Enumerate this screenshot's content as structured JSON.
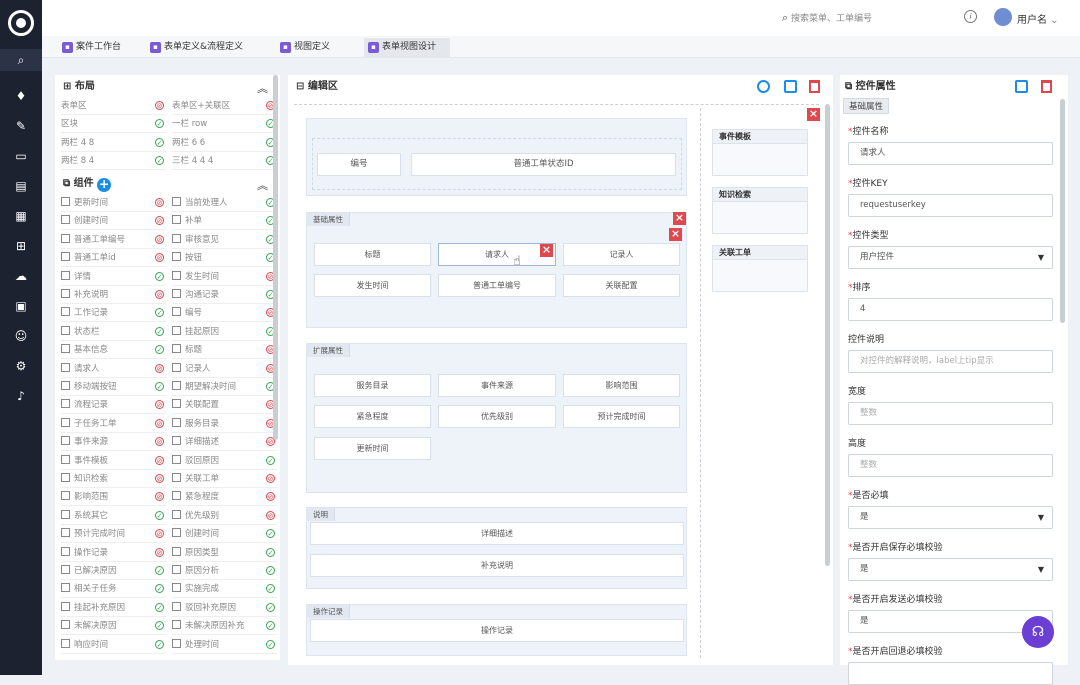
{
  "topbar": {
    "search_placeholder": "搜索菜单、工单编号",
    "username": "用户名",
    "dropdown": "⌄"
  },
  "tabs": [
    "案件工作台",
    "表单定义&流程定义",
    "视图定义",
    "表单视图设计"
  ],
  "layout_panel": {
    "title": "布局",
    "items": [
      {
        "l": "表单区",
        "ls": "no",
        "r": "表单区+关联区",
        "rs": "no"
      },
      {
        "l": "区块",
        "ls": "ok",
        "r": "一栏 row",
        "rs": "ok"
      },
      {
        "l": "两栏 4 8",
        "ls": "ok",
        "r": "两栏 6 6",
        "rs": "ok"
      },
      {
        "l": "两栏 8 4",
        "ls": "ok",
        "r": "三栏 4 4 4",
        "rs": "ok"
      }
    ]
  },
  "components_panel": {
    "title": "组件",
    "add_icon": "+",
    "items": [
      {
        "l": "更新时间",
        "ls": "no",
        "r": "当前处理人",
        "rs": "ok"
      },
      {
        "l": "创建时间",
        "ls": "no",
        "r": "补单",
        "rs": "ok"
      },
      {
        "l": "普通工单编号",
        "ls": "no",
        "r": "审核意见",
        "rs": "ok"
      },
      {
        "l": "普通工单id",
        "ls": "no",
        "r": "按钮",
        "rs": "ok"
      },
      {
        "l": "详情",
        "ls": "ok",
        "r": "发生时间",
        "rs": "no"
      },
      {
        "l": "补充说明",
        "ls": "no",
        "r": "沟通记录",
        "rs": "ok"
      },
      {
        "l": "工作记录",
        "ls": "ok",
        "r": "编号",
        "rs": "no"
      },
      {
        "l": "状态栏",
        "ls": "ok",
        "r": "挂起原因",
        "rs": "ok"
      },
      {
        "l": "基本信息",
        "ls": "ok",
        "r": "标题",
        "rs": "no"
      },
      {
        "l": "请求人",
        "ls": "no",
        "r": "记录人",
        "rs": "no"
      },
      {
        "l": "移动端按钮",
        "ls": "ok",
        "r": "期望解决时间",
        "rs": "ok"
      },
      {
        "l": "流程记录",
        "ls": "no",
        "r": "关联配置",
        "rs": "no"
      },
      {
        "l": "子任务工单",
        "ls": "no",
        "r": "服务目录",
        "rs": "no"
      },
      {
        "l": "事件来源",
        "ls": "no",
        "r": "详细描述",
        "rs": "no"
      },
      {
        "l": "事件模板",
        "ls": "no",
        "r": "驳回原因",
        "rs": "ok"
      },
      {
        "l": "知识检索",
        "ls": "no",
        "r": "关联工单",
        "rs": "no"
      },
      {
        "l": "影响范围",
        "ls": "no",
        "r": "紧急程度",
        "rs": "no"
      },
      {
        "l": "系统其它",
        "ls": "ok",
        "r": "优先级别",
        "rs": "no"
      },
      {
        "l": "预计完成时间",
        "ls": "no",
        "r": "创建时间",
        "rs": "ok"
      },
      {
        "l": "操作记录",
        "ls": "no",
        "r": "原因类型",
        "rs": "ok"
      },
      {
        "l": "已解决原因",
        "ls": "ok",
        "r": "原因分析",
        "rs": "ok"
      },
      {
        "l": "相关子任务",
        "ls": "ok",
        "r": "实施完成",
        "rs": "ok"
      },
      {
        "l": "挂起补充原因",
        "ls": "ok",
        "r": "驳回补充原因",
        "rs": "ok"
      },
      {
        "l": "未解决原因",
        "ls": "ok",
        "r": "未解决原因补充",
        "rs": "ok"
      },
      {
        "l": "响应时间",
        "ls": "ok",
        "r": "处理时间",
        "rs": "ok"
      }
    ]
  },
  "editor": {
    "title": "编辑区",
    "header_fields": [
      "编号",
      "普通工单状态ID"
    ],
    "sections": [
      {
        "label": "基础属性",
        "fields": [
          "标题",
          "请求人",
          "记录人",
          "发生时间",
          "普通工单编号",
          "关联配置"
        ]
      },
      {
        "label": "扩展属性",
        "fields": [
          "服务目录",
          "事件来源",
          "影响范围",
          "紧急程度",
          "优先级别",
          "预计完成时间",
          "更新时间"
        ]
      },
      {
        "label": "说明",
        "fields": [
          "详细描述",
          "补充说明"
        ]
      },
      {
        "label": "操作记录",
        "fields": [
          "操作记录"
        ]
      }
    ],
    "right_blocks": [
      "事件模板",
      "知识检索",
      "关联工单"
    ]
  },
  "props_panel": {
    "title": "控件属性",
    "tab": "基础属性",
    "fields": [
      {
        "label": "控件名称",
        "required": true,
        "value": "请求人",
        "placeholder": false,
        "select": false
      },
      {
        "label": "控件KEY",
        "required": true,
        "value": "requestuserkey",
        "placeholder": false,
        "select": false
      },
      {
        "label": "控件类型",
        "required": true,
        "value": "用户控件",
        "placeholder": false,
        "select": true
      },
      {
        "label": "排序",
        "required": true,
        "value": "4",
        "placeholder": false,
        "select": false
      },
      {
        "label": "控件说明",
        "required": false,
        "value": "对控件的解释说明，label上tip显示",
        "placeholder": true,
        "select": false
      },
      {
        "label": "宽度",
        "required": false,
        "value": "整数",
        "placeholder": true,
        "select": false
      },
      {
        "label": "高度",
        "required": false,
        "value": "整数",
        "placeholder": true,
        "select": false
      },
      {
        "label": "是否必填",
        "required": true,
        "value": "是",
        "placeholder": false,
        "select": true
      },
      {
        "label": "是否开启保存必填校验",
        "required": true,
        "value": "是",
        "placeholder": false,
        "select": true
      },
      {
        "label": "是否开启发送必填校验",
        "required": true,
        "value": "是",
        "placeholder": false,
        "select": false
      },
      {
        "label": "是否开启回退必填校验",
        "required": true,
        "value": "",
        "placeholder": false,
        "select": false
      }
    ]
  }
}
